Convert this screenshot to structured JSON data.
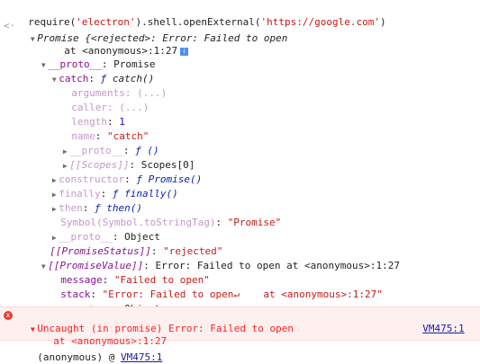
{
  "input": {
    "prefix": "require(",
    "module": "'electron'",
    "middle": ").shell.openExternal(",
    "url": "'https://google.com'",
    "suffix": ")"
  },
  "result_marker": "<·",
  "promise": {
    "head": "Promise {<rejected>: Error: Failed to open",
    "head2": "at <anonymous>:1:27",
    "info": "i"
  },
  "tree": {
    "proto_key": "__proto__",
    "proto_val": ": Promise",
    "catch_key": "catch",
    "catch_val_f": "ƒ",
    "catch_val": "catch()",
    "arguments": "arguments: (...)",
    "caller": "caller: (...)",
    "length_key": "length",
    "length_val": "1",
    "name_key": "name",
    "name_val": "\"catch\"",
    "catch_proto_key": "__proto__",
    "catch_proto_val": "ƒ ()",
    "scopes_key": "[[Scopes]]",
    "scopes_val": ": Scopes[0]",
    "constructor_key": "constructor",
    "constructor_val": "ƒ Promise()",
    "finally_key": "finally",
    "finally_val": "ƒ finally()",
    "then_key": "then",
    "then_val": "ƒ then()",
    "symbol_key": "Symbol(Symbol.toStringTag)",
    "symbol_val": "\"Promise\"",
    "proto2_key": "__proto__",
    "proto2_val": ": Object",
    "status_key": "[[PromiseStatus]]",
    "status_val": "\"rejected\"",
    "value_key": "[[PromiseValue]]",
    "value_val": ": Error: Failed to open at <anonymous>:1:27",
    "message_key": "message",
    "message_val": "\"Failed to open\"",
    "stack_key": "stack",
    "stack_val": "\"Error: Failed to open↵    at <anonymous>:1:27\"",
    "proto3_key": "__proto__",
    "proto3_val": ": Object"
  },
  "error": {
    "line1": "Uncaught (in promise) Error: Failed to open",
    "line2": "at <anonymous>:1:27",
    "source_link": "VM475:1",
    "icon": "x"
  },
  "trace": {
    "frame": "(anonymous) @ ",
    "link": "VM475:1"
  },
  "colors": {
    "error_red": "#fe2020",
    "error_bg": "#fff0f0",
    "key_purple": "#881391",
    "string_red": "#c41a16",
    "number_blue": "#1c00cf"
  }
}
